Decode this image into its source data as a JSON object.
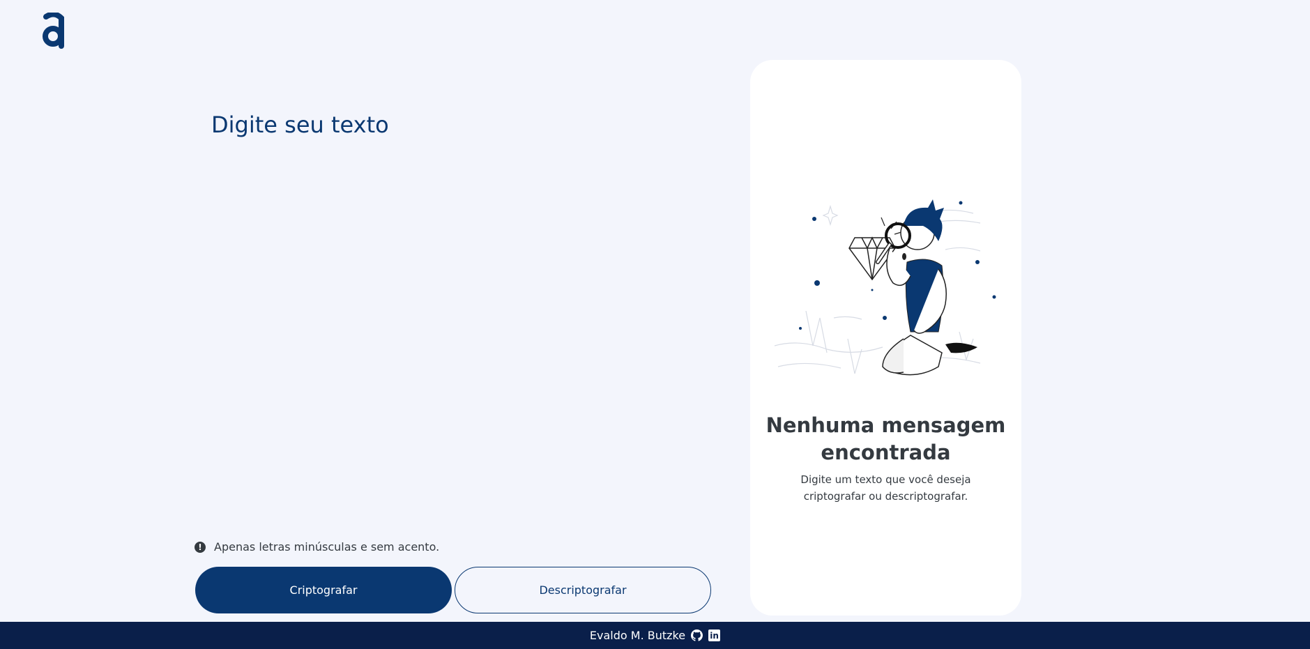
{
  "app": {
    "logo_icon": "alura-logo-icon",
    "colors": {
      "primary": "#0a3871",
      "background": "#f3f5fc",
      "footer": "#0a1f4a",
      "text": "#343a40"
    }
  },
  "input": {
    "placeholder": "Digite seu texto",
    "value": ""
  },
  "hint": {
    "icon": "exclamation-circle-icon",
    "text": "Apenas letras minúsculas e sem acento."
  },
  "buttons": {
    "encrypt_label": "Criptografar",
    "decrypt_label": "Descriptografar"
  },
  "output": {
    "illustration": "person-with-magnifier-looking-at-diamond-illustration",
    "title": "Nenhuma mensagem encontrada",
    "description": "Digite um texto que você deseja criptografar ou descriptografar."
  },
  "footer": {
    "author": "Evaldo M. Butzke",
    "icons": [
      "github-icon",
      "linkedin-icon"
    ]
  }
}
